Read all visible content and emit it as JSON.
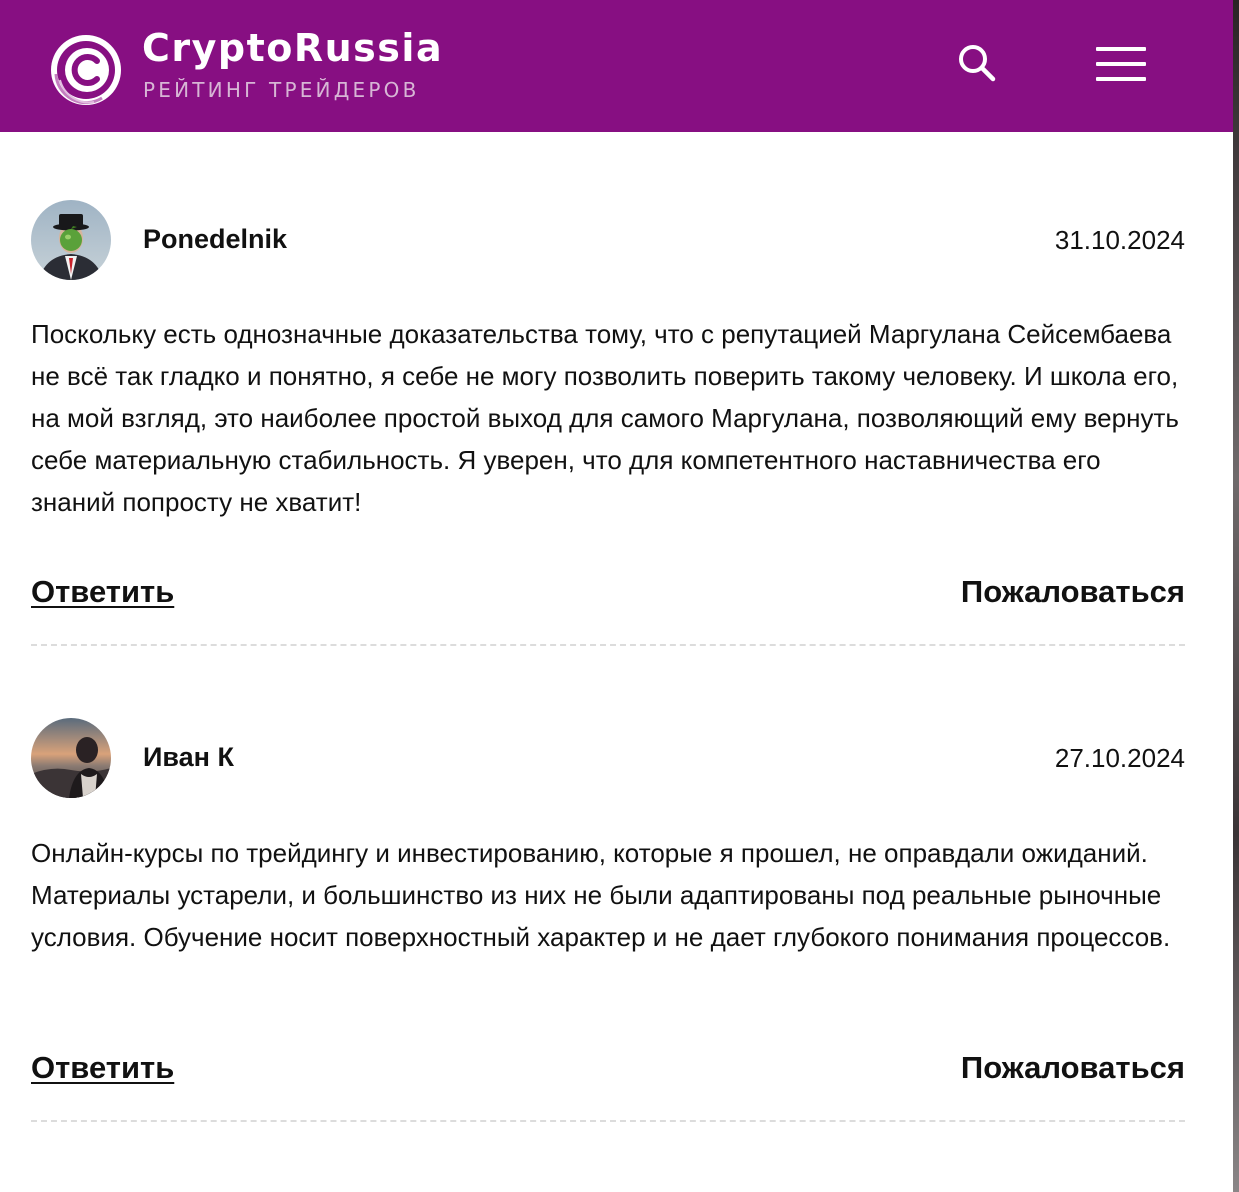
{
  "header": {
    "title": "CryptoRussia",
    "subtitle": "РЕЙТИНГ ТРЕЙДЕРОВ",
    "logo_icon": "c-logo-icon",
    "search_icon": "search-icon",
    "menu_icon": "hamburger-menu-icon",
    "background_color": "#870f82"
  },
  "comments": [
    {
      "author": "Ponedelnik",
      "date": "31.10.2024",
      "avatar": "avatar-man-bowler-hat-green-apple",
      "text": "Поскольку есть однозначные доказательства тому, что с репутацией Маргулана Сейсембаева не всё так гладко и понятно, я себе не могу позволить поверить такому человеку. И школа его, на мой взгляд, это наиболее простой выход для самого Маргулана, позволяющий ему вернуть себе материальную стабильность. Я уверен, что для компетентного наставничества его знаний попросту не хватит!",
      "reply_label": "Ответить",
      "report_label": "Пожаловаться"
    },
    {
      "author": "Иван К",
      "date": "27.10.2024",
      "avatar": "avatar-man-sunset",
      "text": "Онлайн-курсы по трейдингу и инвестированию, которые я прошел, не оправдали ожиданий. Материалы устарели, и большинство из них не были адаптированы под реальные рыночные условия. Обучение носит поверхностный характер и не дает глубокого понимания процессов.",
      "reply_label": "Ответить",
      "report_label": "Пожаловаться"
    }
  ]
}
